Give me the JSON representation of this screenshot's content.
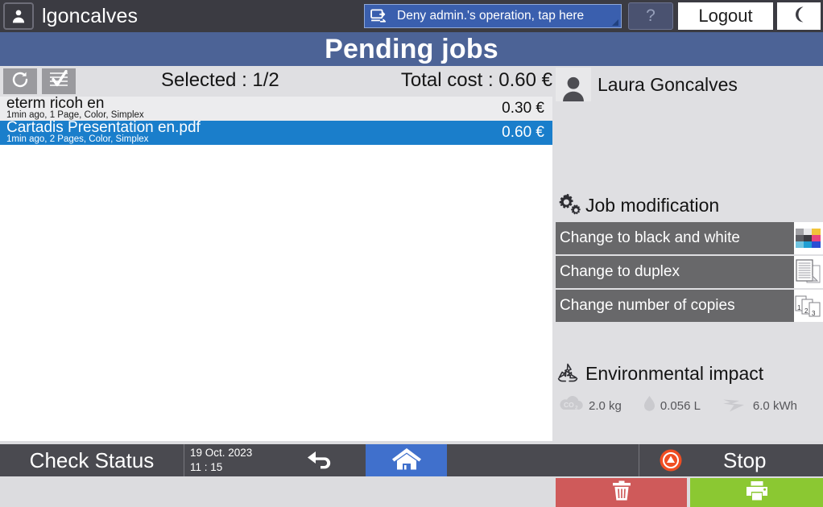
{
  "header": {
    "user_icon": "person-icon",
    "username": "lgoncalves",
    "deny_button": {
      "icon": "transfer-job-icon",
      "label": "Deny admin.'s operation, tap here"
    },
    "help_label": "?",
    "logout_label": "Logout",
    "sleep_icon": "moon-icon"
  },
  "page_title": "Pending jobs",
  "toolbar": {
    "refresh_icon": "refresh-icon",
    "select_all_icon": "select-all-icon",
    "selected_label": "Selected : 1/2",
    "total_cost_label": "Total cost : 0.60 €"
  },
  "jobs": [
    {
      "name": "eterm ricoh en",
      "meta": "1min ago, 1 Page, Color, Simplex",
      "cost": "0.30 €",
      "selected": false
    },
    {
      "name": "Cartadis Presentation en.pdf",
      "meta": "1min ago, 2 Pages, Color, Simplex",
      "cost": "0.60 €",
      "selected": true
    }
  ],
  "right_panel": {
    "avatar_icon": "person-icon",
    "user_fullname": "Laura Goncalves",
    "job_modification": {
      "heading_icon": "gears-icon",
      "heading": "Job modification",
      "options": [
        {
          "label": "Change to black and white",
          "thumb_icon": "color-swatch-icon"
        },
        {
          "label": "Change to duplex",
          "thumb_icon": "duplex-pages-icon"
        },
        {
          "label": "Change number of copies",
          "thumb_icon": "copies-icon"
        }
      ]
    },
    "environmental_impact": {
      "heading_icon": "recycle-icon",
      "heading": "Environmental impact",
      "metrics": [
        {
          "icon": "co2-cloud-icon",
          "value": "2.0 kg"
        },
        {
          "icon": "water-drop-icon",
          "value": "0.056 L"
        },
        {
          "icon": "energy-bolt-icon",
          "value": "6.0 kWh"
        }
      ]
    },
    "actions": {
      "delete_icon": "trash-icon",
      "print_icon": "printer-icon"
    }
  },
  "bottom_bar": {
    "check_status_label": "Check Status",
    "date": "19 Oct. 2023",
    "time": "11 : 15",
    "back_icon": "back-arrow-icon",
    "home_icon": "home-icon",
    "stop_icon": "stop-icon",
    "stop_label": "Stop"
  },
  "colors": {
    "header_bg": "#3b3b42",
    "title_bg": "#4c6396",
    "accent_blue": "#1a7ecb",
    "deny_blue": "#3a5fae",
    "delete_red": "#cf5a5a",
    "print_green": "#8bc832",
    "home_blue": "#4070cc",
    "stop_orange": "#f04e23"
  }
}
